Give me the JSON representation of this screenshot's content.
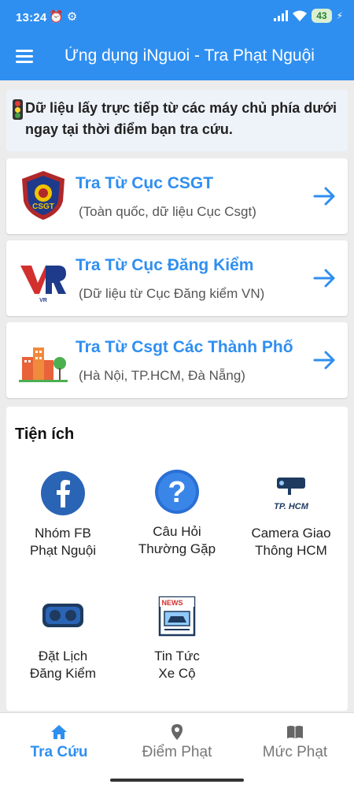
{
  "status_bar": {
    "time": "13:24",
    "icons": "⏰ ⚙",
    "battery": "43",
    "charging": "⚡"
  },
  "app_bar": {
    "title": "Ứng dụng iNguoi - Tra Phạt Nguội"
  },
  "notice": {
    "text": "Dữ liệu lấy trực tiếp từ các máy chủ phía dưới ngay tại thời điểm bạn tra cứu."
  },
  "cards": [
    {
      "title": "Tra Từ Cục CSGT",
      "subtitle": "(Toàn quốc, dữ liệu Cục Csgt)",
      "logo_text": "CSGT",
      "icon": "csgt-badge-icon"
    },
    {
      "title": "Tra Từ Cục Đăng Kiểm",
      "subtitle": "(Dữ liệu từ Cục Đăng kiểm VN)",
      "logo_text": "VR",
      "icon": "vr-logo-icon"
    },
    {
      "title": "Tra Từ Csgt Các Thành Phố",
      "subtitle": "(Hà Nội, TP.HCM, Đà Nẵng)",
      "icon": "city-buildings-icon"
    }
  ],
  "utilities": {
    "heading": "Tiện ích",
    "items": [
      {
        "label": "Nhóm FB\nPhạt Nguội",
        "icon": "facebook-icon"
      },
      {
        "label": "Câu Hỏi\nThường Gặp",
        "icon": "question-icon"
      },
      {
        "label": "Camera Giao\nThông HCM",
        "icon": "camera-icon",
        "icon_text": "TP. HCM"
      },
      {
        "label": "Đặt Lịch\nĐăng Kiểm",
        "icon": "vr-goggles-icon"
      },
      {
        "label": "Tin Tức\nXe Cộ",
        "icon": "news-icon",
        "icon_text": "NEWS"
      }
    ]
  },
  "bottom_nav": [
    {
      "label": "Tra Cứu",
      "icon": "home-icon",
      "active": true
    },
    {
      "label": "Điểm Phạt",
      "icon": "location-pin-icon",
      "active": false
    },
    {
      "label": "Mức Phạt",
      "icon": "book-icon",
      "active": false
    }
  ],
  "colors": {
    "primary": "#2f8ff0",
    "background": "#ececec",
    "notice_bg": "#eef3fa",
    "text_muted": "#555555"
  }
}
